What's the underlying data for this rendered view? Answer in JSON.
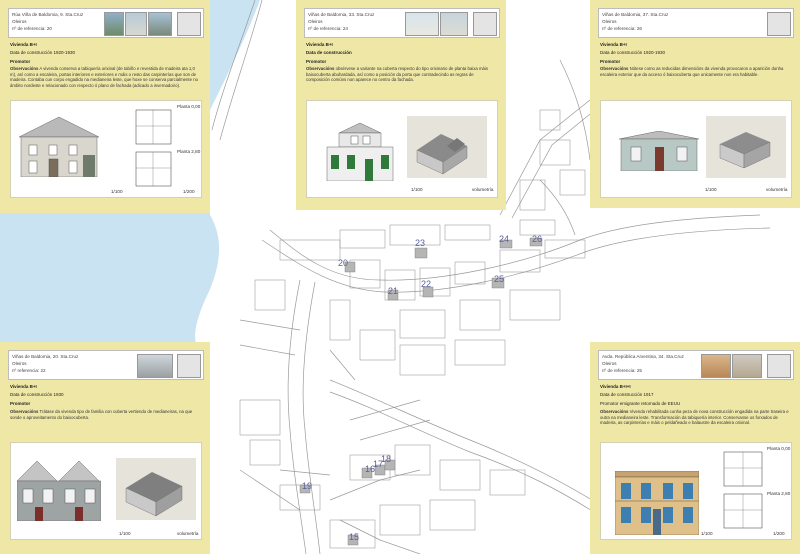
{
  "panels": {
    "p20": {
      "title": "Rúa Viña de Baldomia, 9. Sta.Cruz",
      "place": "Oleiros",
      "ref": "nº de referencia: 20",
      "vivienda": "Vivienda B+I",
      "data": "Data de construcción 1920-1930",
      "promotor": "Promotor",
      "obs_label": "Observacións",
      "obs": "A vivenda conserva a tabiquería orixinal (de tabiño e revestida de madeira ata 1,0 m), así como a escaleira, portas interiores e exteriores e máis o resto das carpinterías que son de madeira. Contaba cun corpo engadido na medianeira leste, que hoxe se conserva parcialmente no ámbito nordeste e relacionado con respecto ó plano de fachada (adicado a invernadoiro).",
      "plan_top": "Planta 0,00",
      "plan_bottom": "Planta 2,80",
      "scale_a": "1/100",
      "scale_b": "1/200"
    },
    "p24": {
      "title": "Viñas de Baldomia, 33. Sta.Cruz",
      "place": "Oleiros",
      "ref": "nº de referencia: 24",
      "vivienda": "Vivienda B+I",
      "data": "Data de construcción",
      "promotor": "Promotor",
      "obs_label": "Observacións",
      "obs": "obsérvese a variante na cuberta respecto do tipo orixinario de planta baixa máis baixocuberta abuhardada, así como a posición da porta que contradecindo as regras de composición comúns non aparece no centro da fachada.",
      "scale_a": "1/100",
      "scale_b": "volumetría"
    },
    "p26": {
      "title": "Viñas de Baldomia, 37. Sta.Cruz",
      "place": "Oleiros",
      "ref": "nº de referencia: 26",
      "vivienda": "Vivienda B+I",
      "data": "Data de construcción 1920-1930",
      "promotor": "Promotor",
      "obs_label": "Observacións",
      "obs": "Nótese como as reducidas dimensións da vivenda provocaron a aparición dunha escaleira exterior que da acceso ó baixocuberta que unicamente non era habitable.",
      "scale_a": "1/100",
      "scale_b": "volumetría"
    },
    "p22": {
      "title": "Viñas de Baldomia, 20. Sta.Cruz",
      "place": "Oleiros",
      "ref": "nº referencia: 22",
      "vivienda": "Vivienda B+I",
      "data": "Data de construcción 1930",
      "promotor": "Promotor",
      "obs_label": "Observacións",
      "obs": "Trátase da vivenda tipo de familia con cuberta vertiendo de medianeiras, na que sonde o aproveitamento do baixocuberta.",
      "scale_a": "1/100",
      "scale_b": "volumetría"
    },
    "p25": {
      "title": "Avda. República Arxentina, 34. Sta.Cruz",
      "place": "Oleiros",
      "ref": "nº de referencia: 25",
      "vivienda": "Vivienda B+I+I",
      "data": "Data de construcción 1917",
      "promotor": "Promotor emigrante retornado de EEUU",
      "obs_label": "Observacións",
      "obs": "Vivenda rehabilitada cunha peza de nova construcción engadida na parte traseira e outra na medianeira leste. Transformación da tabiquería interior. Conservanse os forxados de madeira, as carpinterías e máis o peldañeado e balaustre da escaleira orixinal.",
      "plan_top": "Planta 0,00",
      "plan_bottom": "Planta 2,80",
      "scale_a": "1/100",
      "scale_b": "1/200"
    }
  },
  "map_numbers": [
    "20",
    "23",
    "21",
    "22",
    "24",
    "26",
    "25",
    "16",
    "17",
    "18",
    "19",
    "15"
  ],
  "colors": {
    "panel": "#efe7a6",
    "water": "#c9e3f2",
    "roads": "#9a9a9a",
    "numbers": "#5a5f9a"
  }
}
